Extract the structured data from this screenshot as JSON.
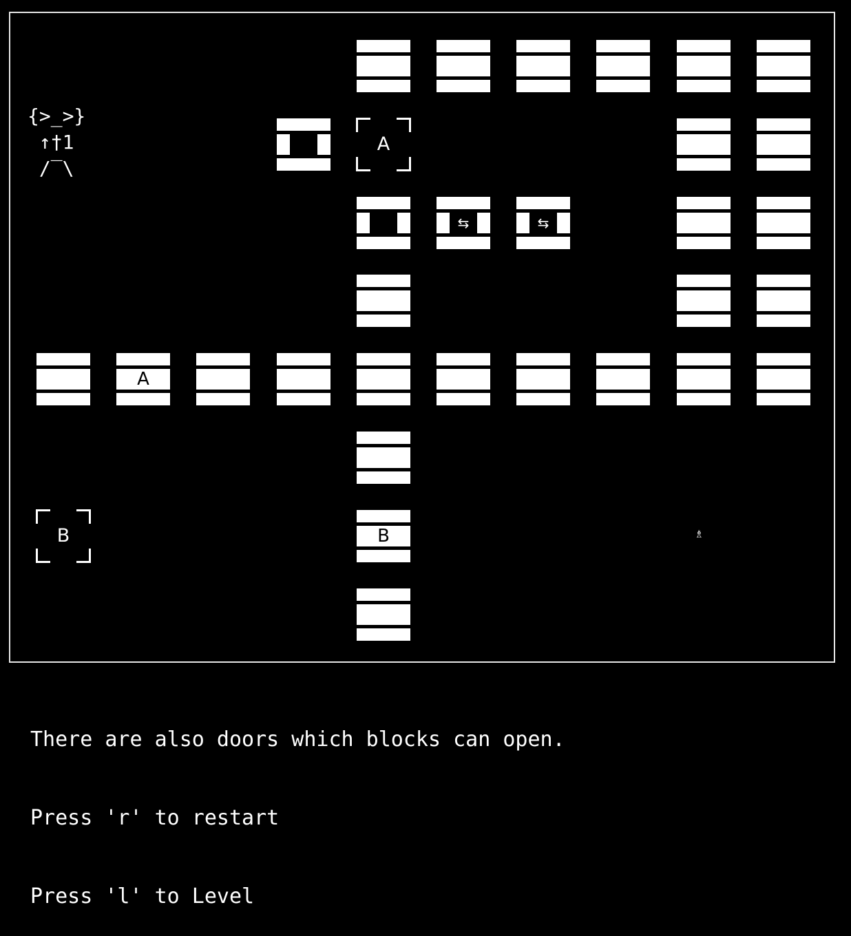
{
  "player": {
    "glyph": "{>_>}\n ↑†1\n /‾\\"
  },
  "goal": {
    "glyph": "♗"
  },
  "walls": [
    [
      4,
      0
    ],
    [
      5,
      0
    ],
    [
      6,
      0
    ],
    [
      7,
      0
    ],
    [
      8,
      0
    ],
    [
      9,
      0
    ],
    [
      8,
      1
    ],
    [
      9,
      1
    ],
    [
      8,
      2
    ],
    [
      9,
      2
    ],
    [
      4,
      3
    ],
    [
      8,
      3
    ],
    [
      9,
      3
    ],
    [
      0,
      4
    ],
    [
      2,
      4
    ],
    [
      3,
      4
    ],
    [
      4,
      4
    ],
    [
      5,
      4
    ],
    [
      6,
      4
    ],
    [
      7,
      4
    ],
    [
      8,
      4
    ],
    [
      9,
      4
    ],
    [
      4,
      5
    ],
    [
      4,
      7
    ]
  ],
  "doors": [
    {
      "col": 3,
      "row": 1,
      "label": "",
      "style": "dark"
    },
    {
      "col": 4,
      "row": 2,
      "label": "",
      "style": "dark"
    },
    {
      "col": 5,
      "row": 2,
      "label": "⇆",
      "style": "sym"
    },
    {
      "col": 6,
      "row": 2,
      "label": "⇆",
      "style": "sym"
    },
    {
      "col": 1,
      "row": 4,
      "label": "A",
      "style": ""
    },
    {
      "col": 4,
      "row": 6,
      "label": "B",
      "style": ""
    }
  ],
  "targets": [
    {
      "col": 4,
      "row": 1,
      "label": "A"
    },
    {
      "col": 0,
      "row": 6,
      "label": "B"
    }
  ],
  "messages": [
    "There are also doors which blocks can open.",
    "Press 'r' to restart",
    "Press 'l' to Level"
  ]
}
